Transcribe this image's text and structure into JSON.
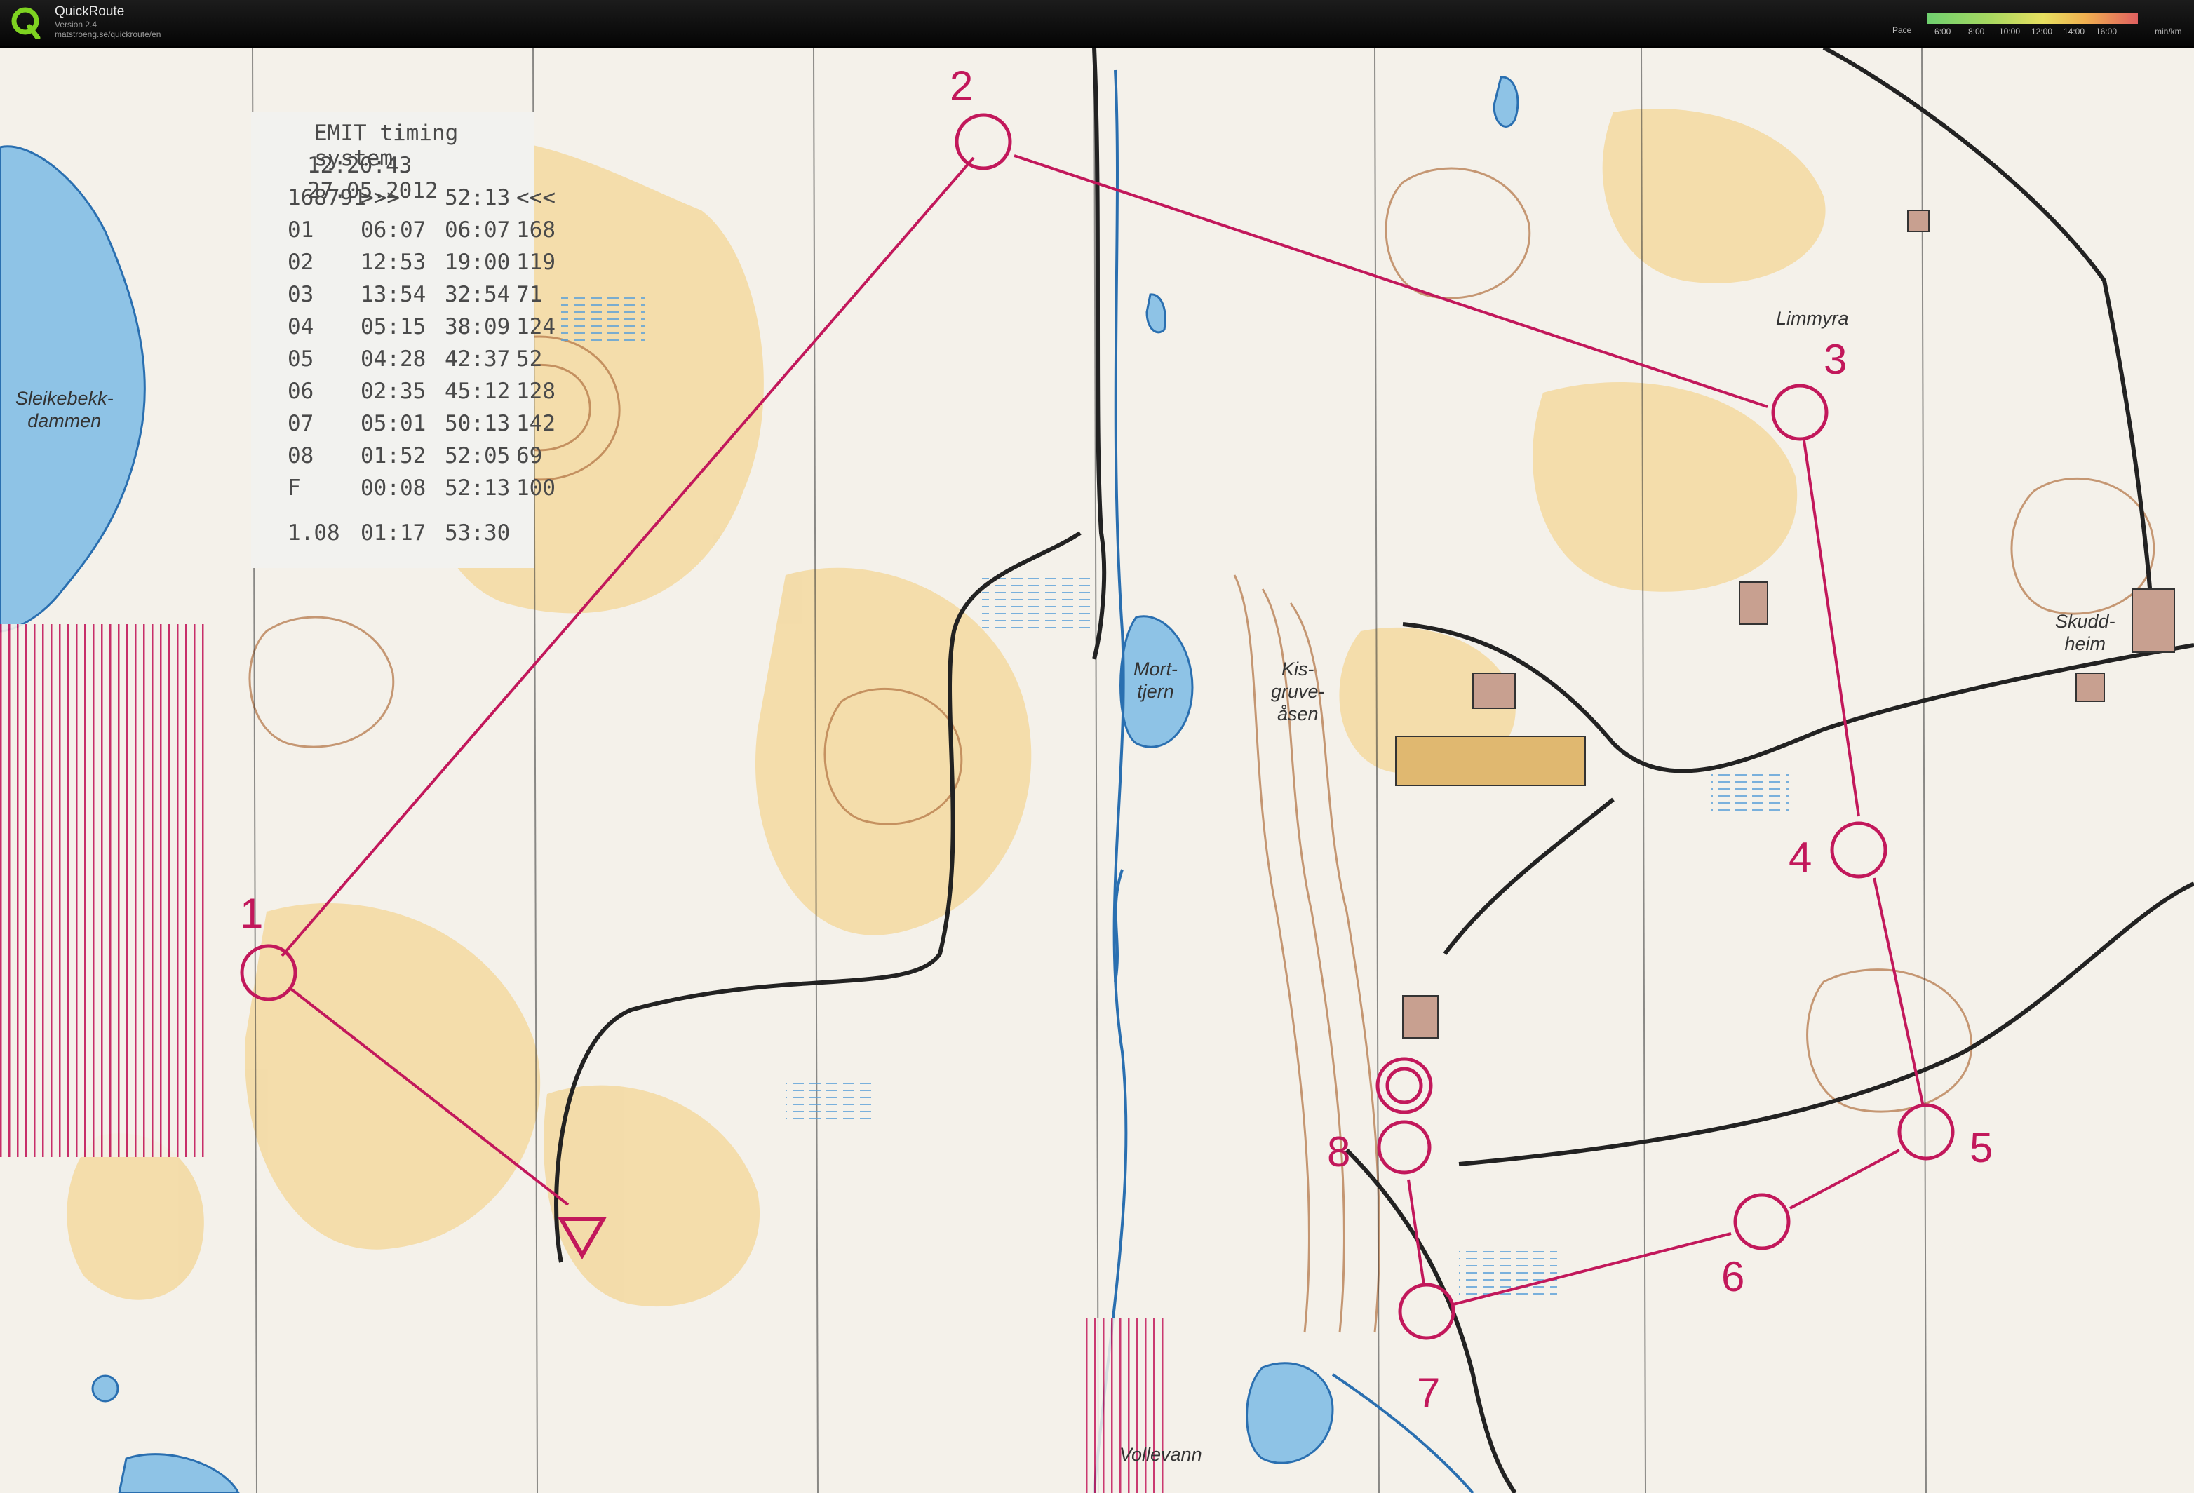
{
  "app": {
    "name": "QuickRoute",
    "version": "Version 2.4",
    "url": "matstroeng.se/quickroute/en"
  },
  "pace_legend": {
    "label": "Pace",
    "ticks": [
      "6:00",
      "8:00",
      "10:00",
      "12:00",
      "14:00",
      "16:00"
    ],
    "unit": "min/km"
  },
  "receipt": {
    "title": "EMIT timing system",
    "datetime": "12:20:43  27.05.2012",
    "rows": [
      [
        "168791",
        ">>>",
        "52:13",
        "<<<"
      ],
      [
        "01",
        "06:07",
        "06:07",
        "168"
      ],
      [
        "02",
        "12:53",
        "19:00",
        "119"
      ],
      [
        "03",
        "13:54",
        "32:54",
        "71"
      ],
      [
        "04",
        "05:15",
        "38:09",
        "124"
      ],
      [
        "05",
        "04:28",
        "42:37",
        "52"
      ],
      [
        "06",
        "02:35",
        "45:12",
        "128"
      ],
      [
        "07",
        "05:01",
        "50:13",
        "142"
      ],
      [
        "08",
        "01:52",
        "52:05",
        "69"
      ],
      [
        "F",
        "00:08",
        "52:13",
        "100"
      ],
      [
        "1.08",
        "01:17",
        "53:30",
        ""
      ]
    ]
  },
  "place_names": {
    "sleikebekkdammen": "Sleikebekk-\ndammen",
    "morttjern": "Mort-\ntjern",
    "kisgruveasen": "Kis-\ngruve-\nåsen",
    "limmyra": "Limmyra",
    "skuddheim": "Skudd-\nheim",
    "vollevann": "Vollevann"
  },
  "control_numbers": [
    "1",
    "2",
    "3",
    "4",
    "5",
    "6",
    "7",
    "8"
  ],
  "colors": {
    "course": "#c2185b",
    "paper": "#f4f1ea",
    "forest_yellow": "#f3d9a0",
    "contour": "#b07040",
    "water": "#8ec3e6"
  }
}
